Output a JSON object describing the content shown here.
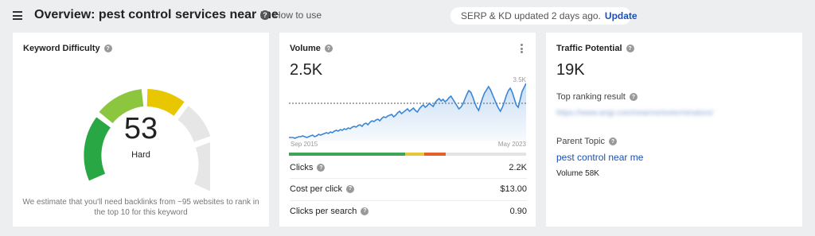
{
  "header": {
    "title": "Overview: pest control services near me",
    "how_to_label": "How to use",
    "serp_status": "SERP & KD updated 2 days ago.",
    "update_label": "Update"
  },
  "keyword_difficulty": {
    "title": "Keyword Difficulty",
    "value": "53",
    "score": 53,
    "level": "Hard",
    "note": "We estimate that you'll need backlinks from ~95 websites to rank in the top 10 for this keyword",
    "colors": {
      "green": "#29a745",
      "lightgreen": "#8cc63f",
      "yellow": "#e8c600",
      "gray": "#e6e6e6"
    }
  },
  "volume": {
    "title": "Volume",
    "value": "2.5K",
    "axis_max": "3.5K",
    "axis_start": "Sep 2015",
    "axis_end": "May 2023",
    "line_color": "#3a86d6",
    "intent_segments": [
      {
        "fraction": 0.49,
        "color": "#3fa556"
      },
      {
        "fraction": 0.08,
        "color": "#e8c63a"
      },
      {
        "fraction": 0.09,
        "color": "#e6612a"
      },
      {
        "fraction": 0.34,
        "color": "#e4e4e4"
      }
    ],
    "metrics": [
      {
        "label": "Clicks",
        "value": "2.2K"
      },
      {
        "label": "Cost per click",
        "value": "$13.00"
      },
      {
        "label": "Clicks per search",
        "value": "0.90"
      }
    ]
  },
  "traffic_potential": {
    "title": "Traffic Potential",
    "value": "19K",
    "top_ranking_label": "Top ranking result",
    "top_ranking_url": "https://www.angi.com/nearme/exterminators/",
    "parent_topic_label": "Parent Topic",
    "parent_topic": "pest control near me",
    "parent_volume": "Volume 58K"
  }
}
